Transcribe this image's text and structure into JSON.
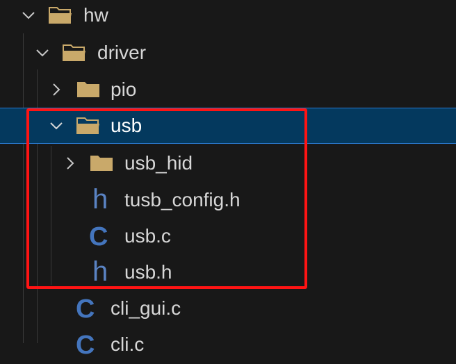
{
  "tree": {
    "hw": {
      "label": "hw",
      "chevron": "chevron-down-icon",
      "icon": "open-folder-icon"
    },
    "driver": {
      "label": "driver",
      "chevron": "chevron-down-icon",
      "icon": "open-folder-icon"
    },
    "pio": {
      "label": "pio",
      "chevron": "chevron-right-icon",
      "icon": "folder-icon"
    },
    "usb": {
      "label": "usb",
      "chevron": "chevron-down-icon",
      "icon": "open-folder-icon",
      "selected": true
    },
    "usb_hid": {
      "label": "usb_hid",
      "chevron": "chevron-right-icon",
      "icon": "folder-icon"
    },
    "tusb_config": {
      "label": "tusb_config.h",
      "icon": "h-file-icon",
      "glyph": "h"
    },
    "usb_c": {
      "label": "usb.c",
      "icon": "c-file-icon",
      "glyph": "C"
    },
    "usb_h": {
      "label": "usb.h",
      "icon": "h-file-icon",
      "glyph": "h"
    },
    "cli_gui": {
      "label": "cli_gui.c",
      "icon": "c-file-icon",
      "glyph": "C"
    },
    "cli_c": {
      "label": "cli.c",
      "icon": "c-file-icon",
      "glyph": "C"
    }
  },
  "colors": {
    "background": "#181818",
    "selection": "#04395e",
    "highlight_box": "#ff1414",
    "folder": "#c9a96a",
    "c_icon": "#4475bd",
    "h_icon": "#5a83c3"
  }
}
